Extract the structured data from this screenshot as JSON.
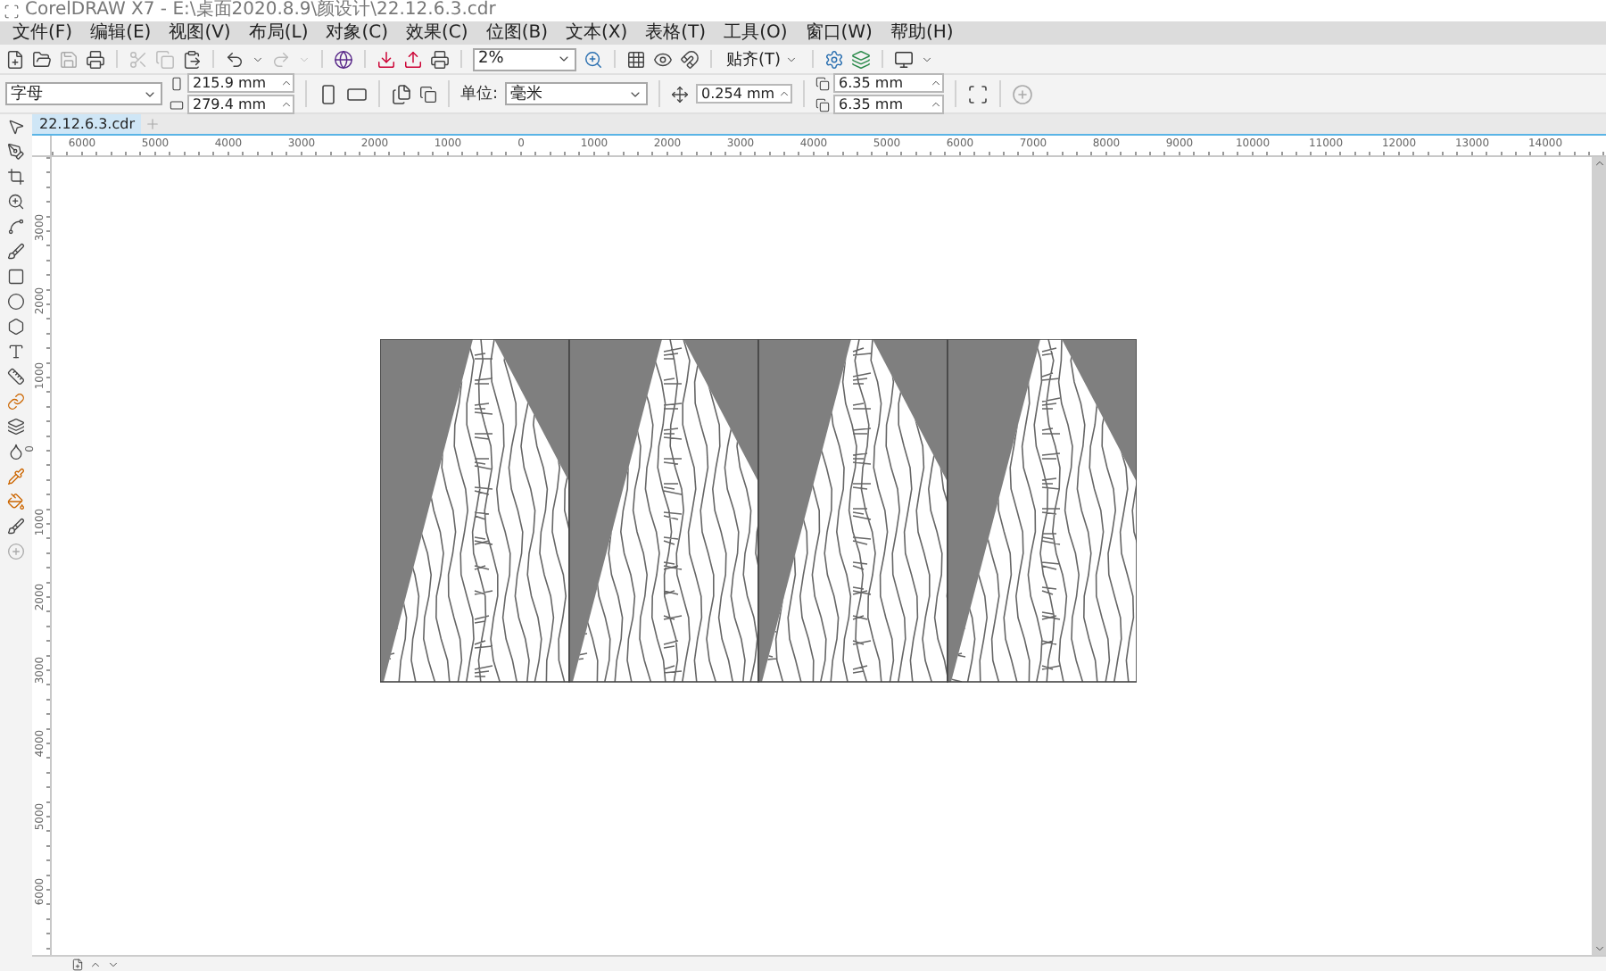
{
  "window": {
    "title": "CorelDRAW X7 - E:\\桌面2020.8.9\\颜设计\\22.12.6.3.cdr"
  },
  "menu": [
    "文件(F)",
    "编辑(E)",
    "视图(V)",
    "布局(L)",
    "对象(C)",
    "效果(C)",
    "位图(B)",
    "文本(X)",
    "表格(T)",
    "工具(O)",
    "窗口(W)",
    "帮助(H)"
  ],
  "toolbar": {
    "zoom": "2%",
    "snap": "贴齐(T)"
  },
  "property_bar": {
    "preset": "字母",
    "width": "215.9 mm",
    "height": "279.4 mm",
    "units_label": "单位:",
    "units": "毫米",
    "nudge": "0.254 mm",
    "duplicate_x": "6.35 mm",
    "duplicate_y": "6.35 mm"
  },
  "document_tab": "22.12.6.3.cdr",
  "rulers": {
    "horizontal": [
      "6000",
      "5000",
      "4000",
      "3000",
      "2000",
      "1000",
      "0",
      "1000",
      "2000",
      "3000",
      "4000",
      "5000",
      "6000",
      "7000",
      "8000",
      "9000",
      "10000",
      "11000",
      "12000",
      "13000",
      "14000"
    ],
    "vertical": [
      "3000",
      "2000",
      "1000",
      "0",
      "1000",
      "2000",
      "3000",
      "4000",
      "5000",
      "6000"
    ]
  }
}
